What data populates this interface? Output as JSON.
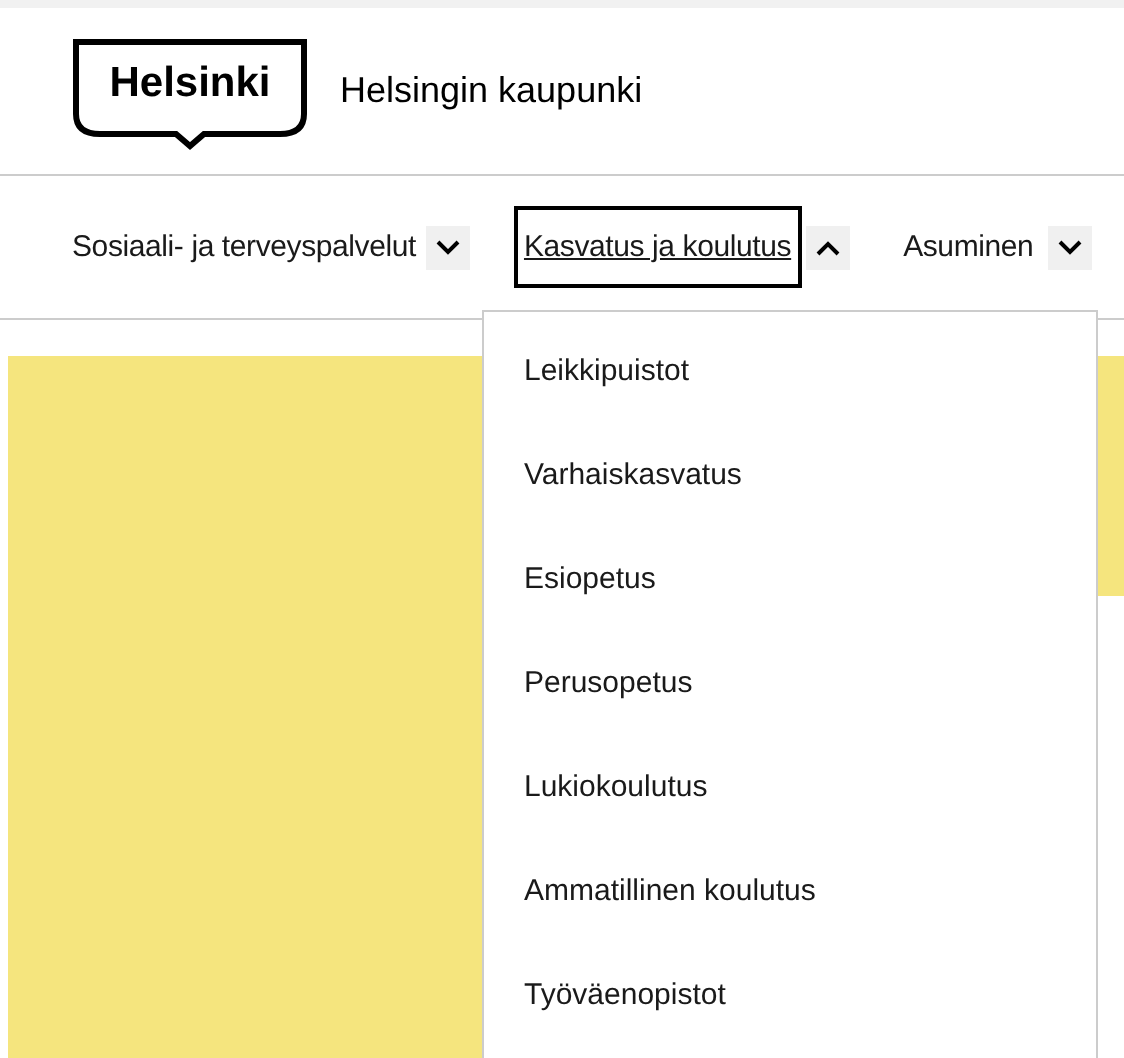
{
  "header": {
    "logo": "Helsinki",
    "site_name": "Helsingin kaupunki"
  },
  "nav_items": [
    {
      "label": "Sosiaali- ja terveyspalvelut",
      "selected": false,
      "expanded": false
    },
    {
      "label": "Kasvatus ja koulutus",
      "selected": true,
      "expanded": true,
      "children": [
        {
          "label": "Leikkipuistot"
        },
        {
          "label": "Varhaiskasvatus"
        },
        {
          "label": "Esiopetus"
        },
        {
          "label": "Perusopetus"
        },
        {
          "label": "Lukiokoulutus"
        },
        {
          "label": "Ammatillinen koulutus"
        },
        {
          "label": "Työväenopistot"
        }
      ]
    },
    {
      "label": "Asuminen",
      "selected": false,
      "expanded": false
    }
  ]
}
